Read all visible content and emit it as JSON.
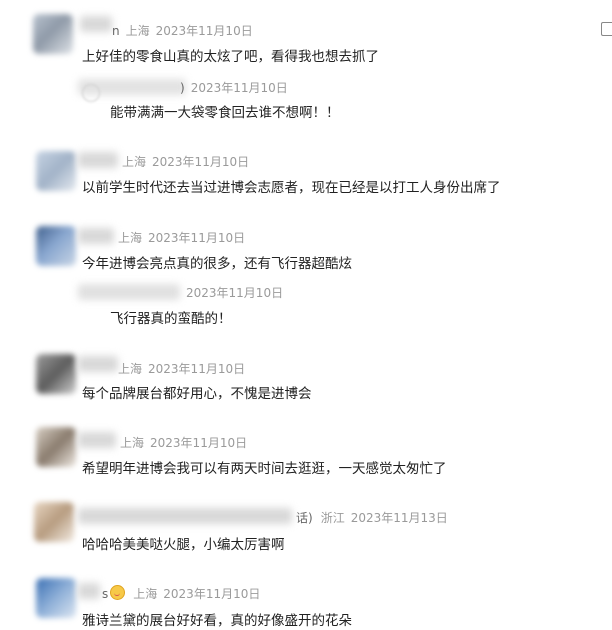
{
  "comments": [
    {
      "location": "上海",
      "date": "2023年11月10日",
      "text": "上好佳的零食山真的太炫了吧，看得我也想去抓了",
      "name_suffix": "n",
      "reply": {
        "name_suffix": ")",
        "date": "2023年11月10日",
        "text": "能带满满一大袋零食回去谁不想啊！！"
      }
    },
    {
      "location": "上海",
      "date": "2023年11月10日",
      "text": "以前学生时代还去当过进博会志愿者，现在已经是以打工人身份出席了"
    },
    {
      "location": "上海",
      "date": "2023年11月10日",
      "text": "今年进博会亮点真的很多，还有飞行器超酷炫",
      "reply": {
        "date": "2023年11月10日",
        "text": "飞行器真的蛮酷的！"
      }
    },
    {
      "location": "上海",
      "date": "2023年11月10日",
      "text": "每个品牌展台都好用心，不愧是进博会"
    },
    {
      "location": "上海",
      "date": "2023年11月10日",
      "text": "希望明年进博会我可以有两天时间去逛逛，一天感觉太匆忙了"
    },
    {
      "name_suffix": "话)",
      "location": "浙江",
      "date": "2023年11月13日",
      "text": "哈哈哈美美哒火腿，小编太厉害啊"
    },
    {
      "name_suffix": "s",
      "location": "上海",
      "date": "2023年11月10日",
      "text": "雅诗兰黛的展台好好看，真的好像盛开的花朵"
    }
  ]
}
